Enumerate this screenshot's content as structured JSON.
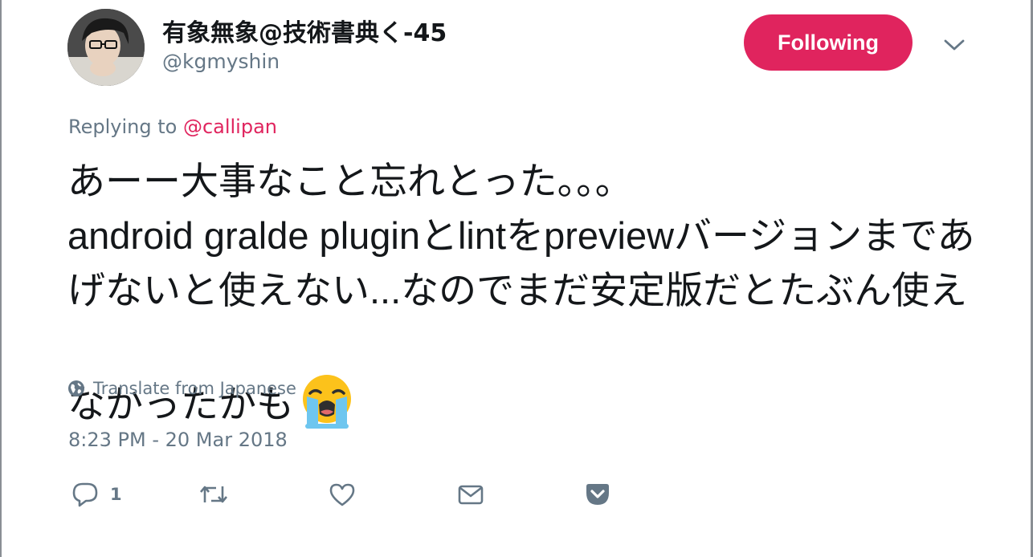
{
  "user": {
    "display_name": "有象無象@技術書典く-45",
    "handle": "@kgmyshin",
    "avatar_icon": "profile-photo"
  },
  "follow_button": {
    "label": "Following",
    "color": "#e0245e"
  },
  "menu": {
    "icon": "chevron-down-icon"
  },
  "reply": {
    "prefix": "Replying to ",
    "mention": "@callipan"
  },
  "tweet": {
    "text": "あーー大事なこと忘れとった。。。\nandroid gralde pluginとlintをpreviewバージョンまであげないと使えない...なのでまだ安定版だとたぶん使えなかったかも",
    "emoji": "loudly-crying-face-emoji"
  },
  "translate": {
    "label": "Translate from Japanese",
    "icon": "globe-icon"
  },
  "timestamp": "8:23 PM - 20 Mar 2018",
  "actions": {
    "reply": {
      "icon": "reply-icon",
      "count": "1"
    },
    "retweet": {
      "icon": "retweet-icon"
    },
    "like": {
      "icon": "heart-icon"
    },
    "dm": {
      "icon": "envelope-icon"
    },
    "pocket": {
      "icon": "pocket-icon"
    }
  },
  "colors": {
    "accent": "#e0245e",
    "muted": "#657786",
    "text": "#14171a"
  }
}
